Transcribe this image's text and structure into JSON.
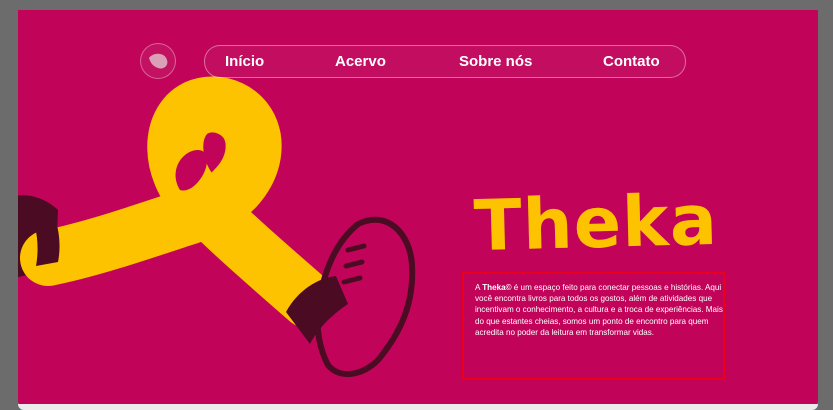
{
  "nav": {
    "logo": "leaf-logo-icon",
    "items": [
      {
        "label": "Início"
      },
      {
        "label": "Acervo"
      },
      {
        "label": "Sobre nós"
      },
      {
        "label": "Contato"
      }
    ]
  },
  "hero": {
    "illustration": "yellow-leg-with-sneaker",
    "title": "Theka",
    "description": {
      "prefix": "A ",
      "brand": "Theka©",
      "text": " é um espaço feito para conectar pessoas e histórias. Aqui você encontra livros para todos os gostos, além de atividades que incentivam o conhecimento, a cultura e a troca de experiências. Mais do que estantes cheias, somos um ponto de encontro para quem acredita no poder da leitura em transformar vidas."
    }
  },
  "colors": {
    "background": "#6c6c6c",
    "hero": "#c1045a",
    "accent_yellow": "#fdc200",
    "dark_maroon": "#4a0b23",
    "highlight_border": "#e8001c"
  }
}
